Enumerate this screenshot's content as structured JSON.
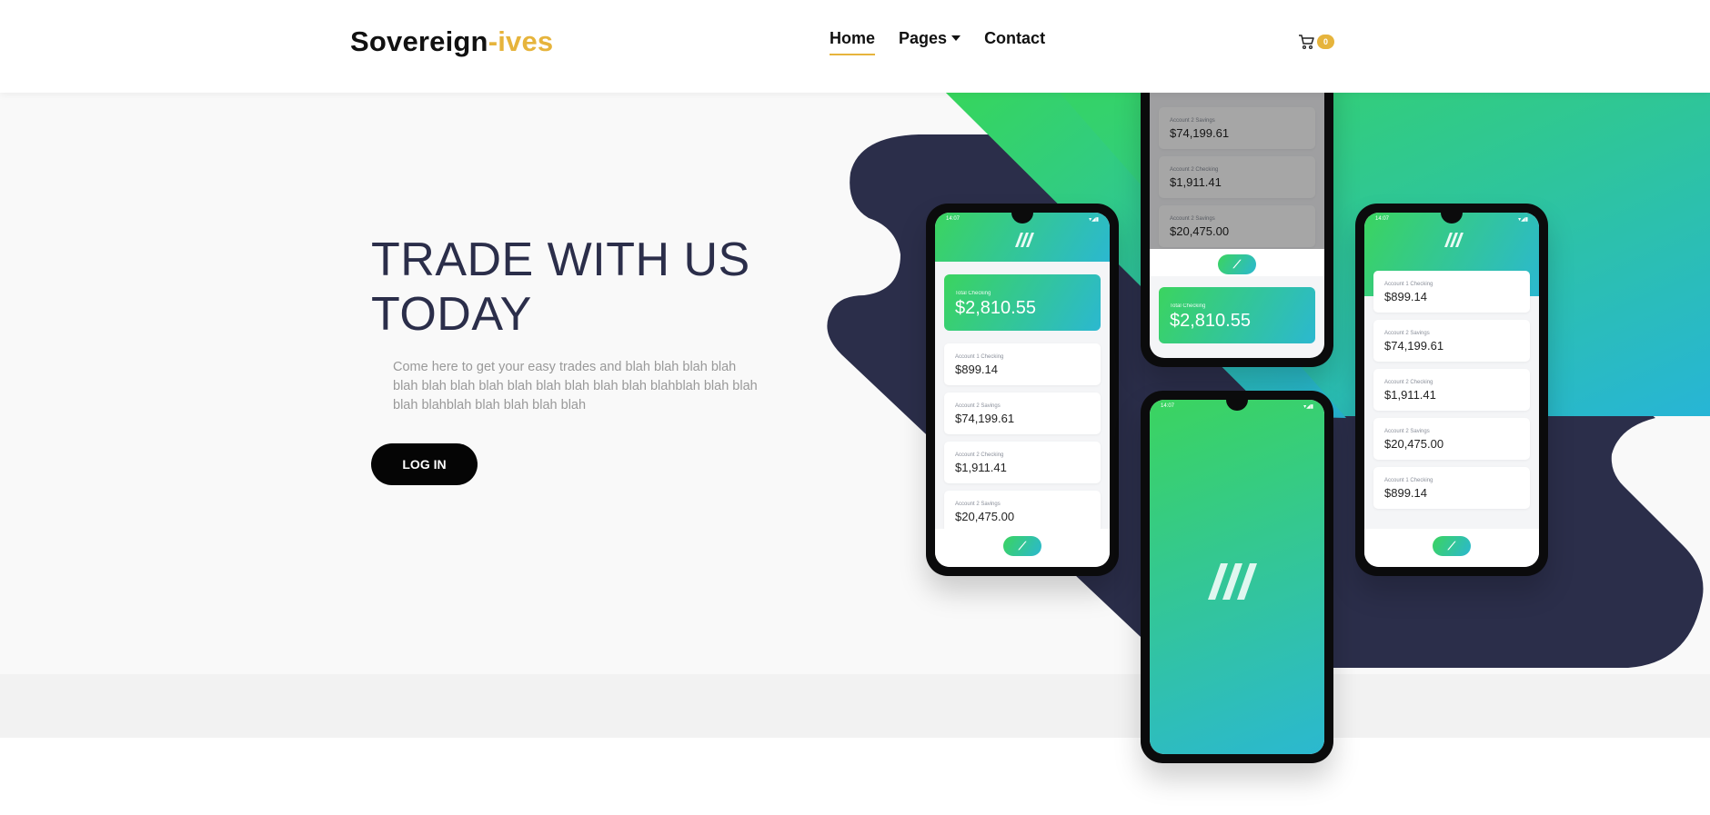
{
  "header": {
    "logo_main": "Sovereign",
    "logo_accent": "-ives",
    "nav": [
      {
        "label": "Home",
        "active": true
      },
      {
        "label": "Pages",
        "dropdown": true
      },
      {
        "label": "Contact"
      }
    ],
    "cart_count": "0"
  },
  "hero": {
    "title_line1": "TRADE WITH US",
    "title_line2": "TODAY",
    "description": "Come here to get your easy trades and blah blah blah blah blah blah blah blah blah blah blah blah blah blahblah blah blah blah blahblah blah blah blah blah",
    "login_label": "LOG IN"
  },
  "phones": {
    "time": "14:07",
    "left": {
      "total_label": "Total Checking",
      "total_value": "$2,810.55",
      "accounts": [
        {
          "label": "Account 1 Checking",
          "value": "$899.14"
        },
        {
          "label": "Account 2 Savings",
          "value": "$74,199.61"
        },
        {
          "label": "Account 2 Checking",
          "value": "$1,911.41"
        },
        {
          "label": "Account 2 Savings",
          "value": "$20,475.00"
        }
      ]
    },
    "top": {
      "accounts": [
        {
          "label": "Account 2 Savings",
          "value": "$74,199.61"
        },
        {
          "label": "Account 2 Checking",
          "value": "$1,911.41"
        },
        {
          "label": "Account 2 Savings",
          "value": "$20,475.00"
        }
      ],
      "total_label": "Total Checking",
      "total_value": "$2,810.55"
    },
    "right": {
      "accounts": [
        {
          "label": "Account 1 Checking",
          "value": "$899.14"
        },
        {
          "label": "Account 2 Savings",
          "value": "$74,199.61"
        },
        {
          "label": "Account 2 Checking",
          "value": "$1,911.41"
        },
        {
          "label": "Account 2 Savings",
          "value": "$20,475.00"
        },
        {
          "label": "Account 1 Checking",
          "value": "$899.14"
        }
      ]
    },
    "fab_icon": "plus-slash-icon"
  },
  "colors": {
    "accent": "#e6b43c",
    "navy": "#2b2e4a",
    "green": "#3bd45f",
    "teal": "#2bb8d0"
  }
}
